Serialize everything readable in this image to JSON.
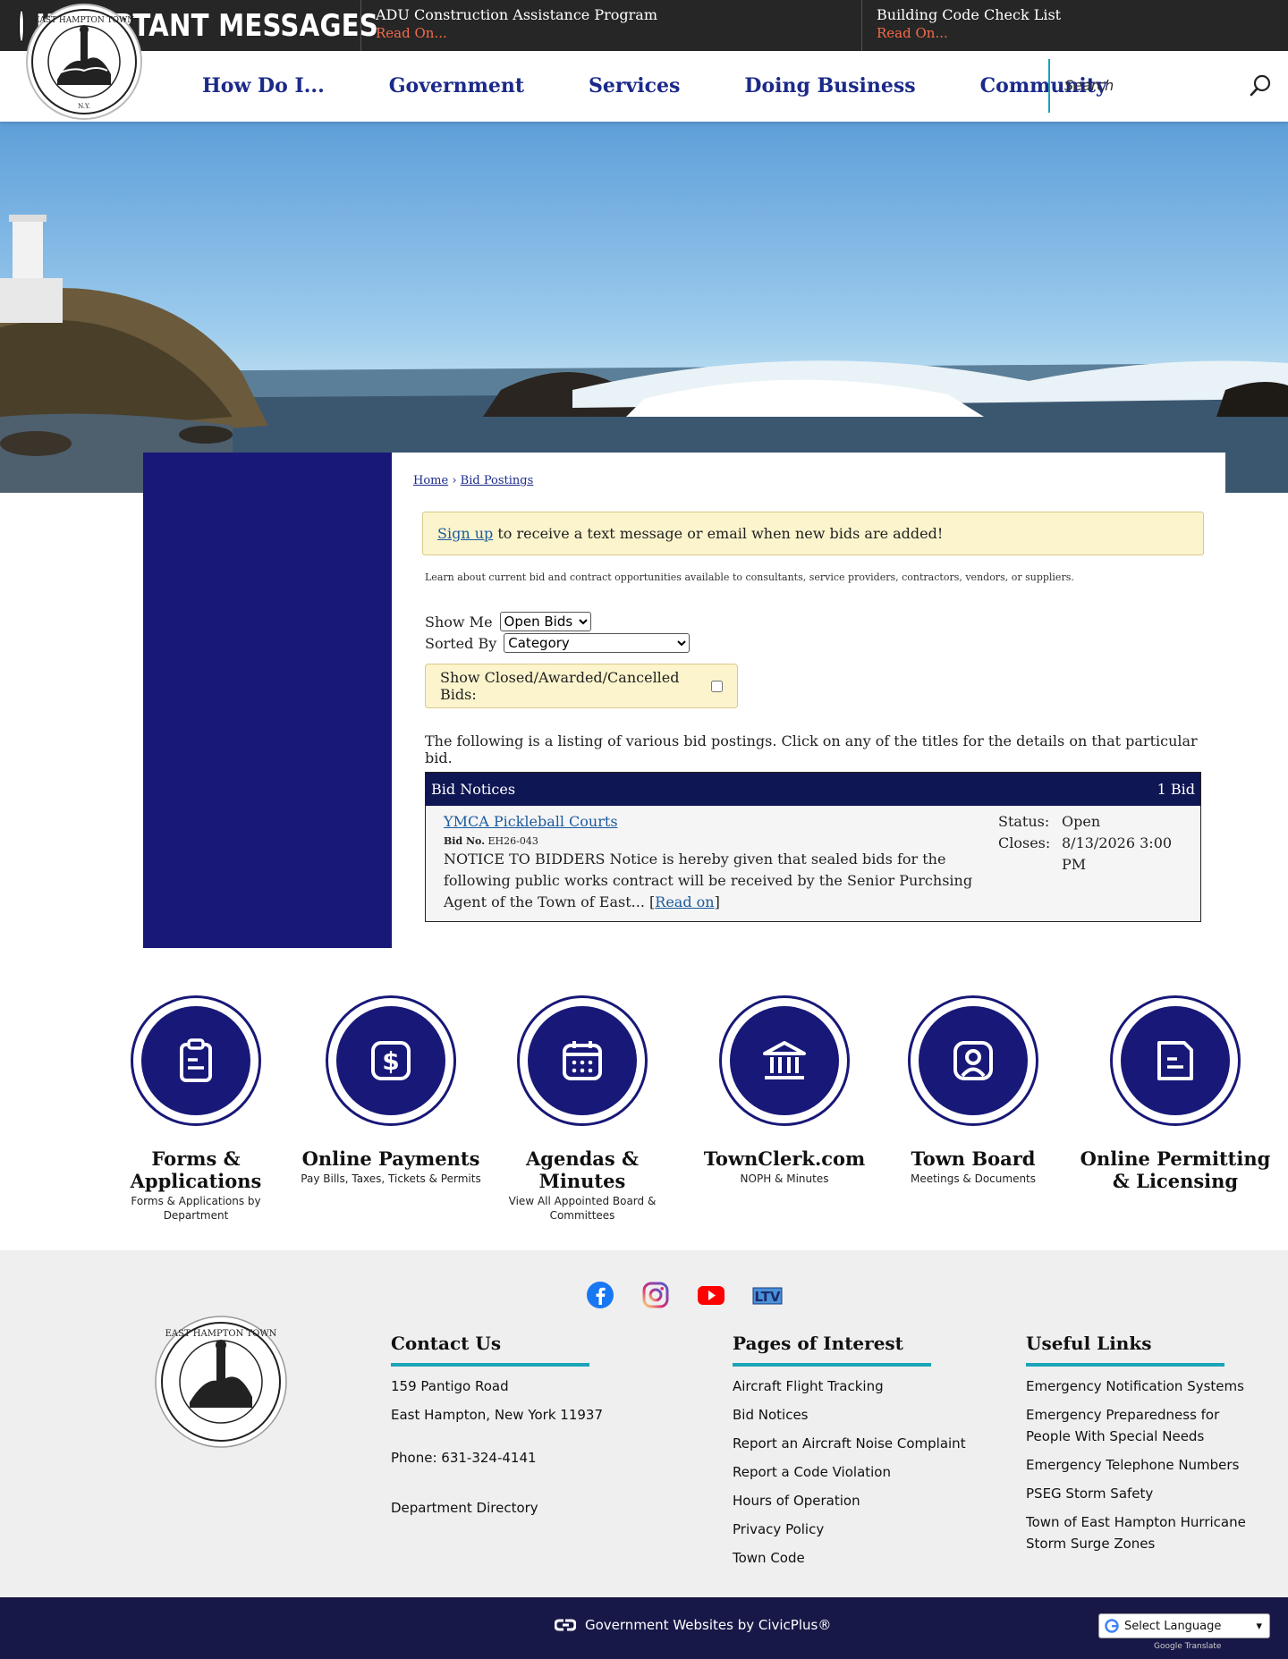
{
  "alerts": {
    "title": "IMPORTANT MESSAGES",
    "items": [
      {
        "title": "ADU Construction Assistance Program",
        "link": "Read On..."
      },
      {
        "title": "Building Code Check List",
        "link": "Read On..."
      }
    ]
  },
  "nav": {
    "items": [
      "How Do I...",
      "Government",
      "Services",
      "Doing Business",
      "Community"
    ]
  },
  "search": {
    "placeholder": "Search"
  },
  "breadcrumb": {
    "home": "Home",
    "separator": "›",
    "current": "Bid Postings"
  },
  "notify": {
    "link": "Sign up",
    "text": " to receive a text message or email when new bids are added!"
  },
  "intro": "Learn about current bid and contract opportunities available to consultants, service providers, contractors, vendors, or suppliers.",
  "filters": {
    "show_me_label": "Show Me",
    "show_me_value": "Open Bids",
    "sorted_by_label": "Sorted By",
    "sorted_by_value": "Category",
    "closed_label": "Show Closed/Awarded/Cancelled Bids:"
  },
  "listing_note": "The following is a listing of various bid postings. Click on any of the titles for the details on that particular bid.",
  "bids": {
    "category": "Bid Notices",
    "count": "1 Bid",
    "items": [
      {
        "title": "YMCA Pickleball Courts",
        "bid_no_label": "Bid No.",
        "bid_no": "EH26-043",
        "description": "NOTICE TO BIDDERS Notice is hereby given that sealed bids for the following public works contract will be received by the Senior Purchsing Agent of the Town of East... ",
        "read_on": "Read on",
        "status_label": "Status:",
        "status": "Open",
        "closes_label": "Closes:",
        "closes": "8/13/2026 3:00 PM"
      }
    ]
  },
  "quick_links": [
    {
      "title": "Forms & Applications",
      "sub": "Forms & Applications by Department",
      "icon": "clipboard-icon"
    },
    {
      "title": "Online Payments",
      "sub": "Pay Bills, Taxes, Tickets & Permits",
      "icon": "dollar-icon"
    },
    {
      "title": "Agendas & Minutes",
      "sub": "View All Appointed Board & Committees",
      "icon": "calendar-icon"
    },
    {
      "title": "TownClerk.com",
      "sub": "NOPH & Minutes",
      "icon": "building-icon"
    },
    {
      "title": "Town Board",
      "sub": "Meetings & Documents",
      "icon": "person-icon"
    },
    {
      "title": "Online Permitting & Licensing",
      "sub": "",
      "icon": "document-icon"
    }
  ],
  "footer": {
    "contact": {
      "heading": "Contact Us",
      "address1": "159 Pantigo Road",
      "address2": "East Hampton, New York 11937",
      "phone": "Phone: 631-324-4141",
      "directory": "Department Directory"
    },
    "pages_of_interest": {
      "heading": "Pages of Interest",
      "items": [
        "Aircraft Flight Tracking",
        "Bid Notices",
        "Report an Aircraft Noise Complaint",
        "Report a Code Violation",
        "Hours of Operation",
        "Privacy Policy",
        "Town Code"
      ]
    },
    "useful_links": {
      "heading": "Useful Links",
      "items": [
        "Emergency Notification Systems",
        "Emergency Preparedness for People With Special Needs",
        "Emergency Telephone Numbers",
        "PSEG Storm Safety",
        "Town of East Hampton Hurricane Storm Surge Zones"
      ]
    },
    "social": [
      "facebook-icon",
      "instagram-icon",
      "youtube-icon",
      "ltv-icon"
    ],
    "ltv_label": "LTV",
    "civicplus": "Government Websites by CivicPlus®",
    "translate": "Select Language",
    "powered": "Google Translate"
  },
  "colors": {
    "navy": "#181878",
    "nav_text": "#1b2a8a",
    "teal": "#1aa4b8",
    "alert_link": "#f36a4a",
    "note_bg": "#fbf4cc"
  }
}
